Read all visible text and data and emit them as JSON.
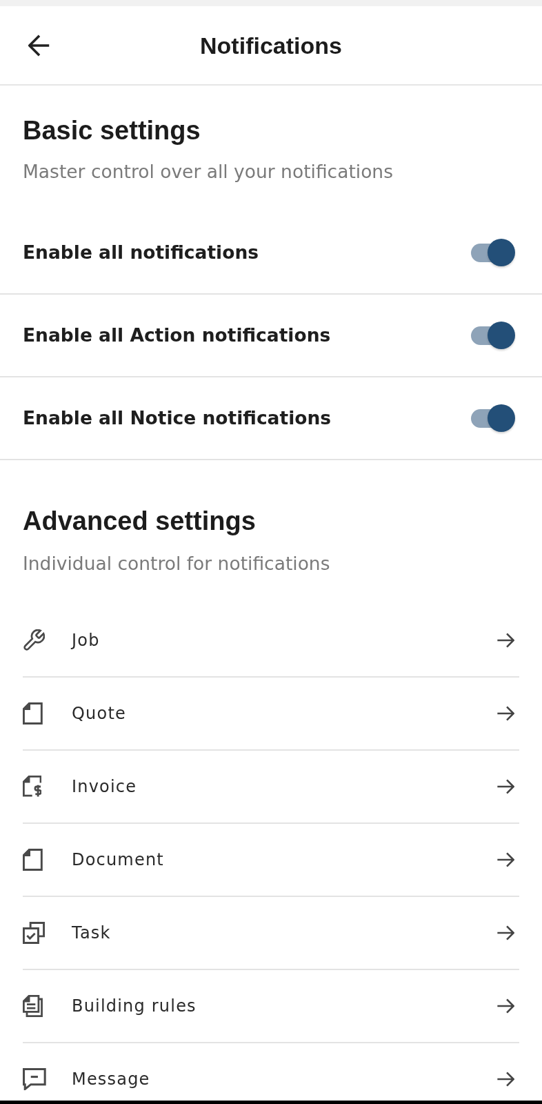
{
  "header": {
    "title": "Notifications"
  },
  "basic_settings": {
    "title": "Basic settings",
    "subtitle": "Master control over all your notifications",
    "toggles": [
      {
        "label": "Enable all notifications",
        "on": true
      },
      {
        "label": "Enable all Action notifications",
        "on": true
      },
      {
        "label": "Enable all Notice notifications",
        "on": true
      }
    ]
  },
  "advanced_settings": {
    "title": "Advanced settings",
    "subtitle": "Individual control for notifications",
    "items": [
      {
        "label": "Job",
        "kind": "job"
      },
      {
        "label": "Quote",
        "kind": "quote"
      },
      {
        "label": "Invoice",
        "kind": "invoice"
      },
      {
        "label": "Document",
        "kind": "document"
      },
      {
        "label": "Task",
        "kind": "task"
      },
      {
        "label": "Building rules",
        "kind": "rules"
      },
      {
        "label": "Message",
        "kind": "message"
      }
    ]
  }
}
